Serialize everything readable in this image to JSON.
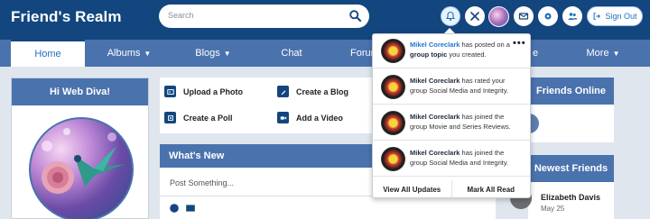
{
  "header": {
    "title": "Friend's Realm",
    "search_placeholder": "Search",
    "signout_label": "Sign Out",
    "icons": [
      "bell-icon",
      "tools-icon",
      "user-avatar",
      "mail-icon",
      "gear-icon",
      "friends-icon",
      "signout-icon"
    ]
  },
  "nav": {
    "items": [
      {
        "label": "Home",
        "dropdown": false
      },
      {
        "label": "Albums",
        "dropdown": true
      },
      {
        "label": "Blogs",
        "dropdown": true
      },
      {
        "label": "Chat",
        "dropdown": false
      },
      {
        "label": "Forum",
        "dropdown": false
      },
      {
        "label": "e",
        "dropdown": false
      },
      {
        "label": "More",
        "dropdown": true
      }
    ]
  },
  "left_card": {
    "title": "Hi Web Diva!"
  },
  "quick_actions": [
    {
      "label": "Upload a Photo",
      "icon": "photo-icon"
    },
    {
      "label": "Create a Blog",
      "icon": "pencil-icon"
    },
    {
      "label": "Create a Poll",
      "icon": "poll-icon"
    },
    {
      "label": "Add a Video",
      "icon": "video-icon"
    }
  ],
  "whats_new": {
    "title": "What's New",
    "post_placeholder": "Post Something..."
  },
  "friends_online": {
    "title": "Friends Online"
  },
  "newest_friends": {
    "title": "Newest Friends",
    "friends": [
      {
        "name": "Elizabeth Davis",
        "date": "May 25"
      }
    ]
  },
  "notifications": {
    "items": [
      {
        "name": "Mikel Coreclark",
        "text_before": " has posted on a ",
        "link": "group topic",
        "text_after": " you created."
      },
      {
        "name": "Mikel Coreclark",
        "text_before": " has rated your group Social Media and Integrity.",
        "link": "",
        "text_after": ""
      },
      {
        "name": "Mikel Coreclark",
        "text_before": " has joined the group Movie and Series Reviews.",
        "link": "",
        "text_after": ""
      },
      {
        "name": "Mikel Coreclark",
        "text_before": " has joined the group Social Media and Integrity.",
        "link": "",
        "text_after": ""
      }
    ],
    "more_label": "•••",
    "view_all": "View All Updates",
    "mark_all": "Mark All Read"
  },
  "colors": {
    "header_bg": "#13467e",
    "nav_bg": "#4a72ad",
    "accent": "#1f6fbf",
    "page_bg": "#dfe6ee"
  }
}
